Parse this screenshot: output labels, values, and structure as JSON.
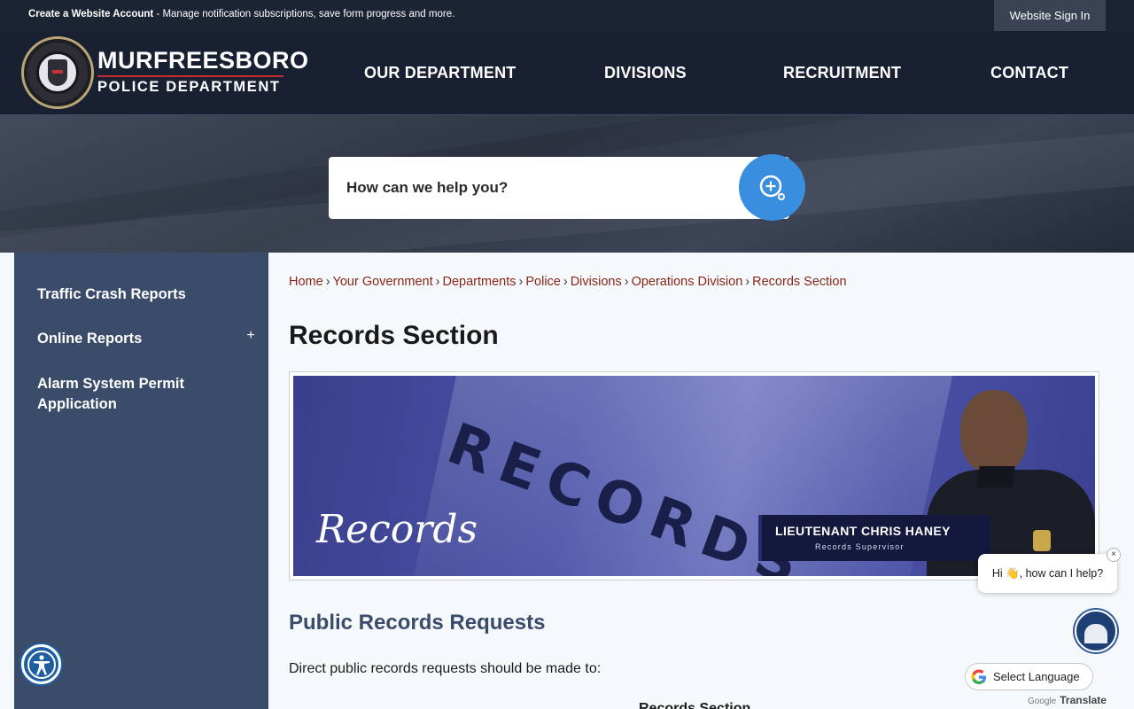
{
  "topbar": {
    "account_strong": "Create a Website Account",
    "account_rest": " - Manage notification subscriptions, save form progress and more.",
    "signin_label": "Website Sign In"
  },
  "header": {
    "logo_line1": "MURFREESBORO",
    "logo_line2": "POLICE DEPARTMENT",
    "nav": [
      "OUR DEPARTMENT",
      "DIVISIONS",
      "RECRUITMENT",
      "CONTACT"
    ]
  },
  "search": {
    "placeholder": "How can we help you?"
  },
  "sidebar": {
    "items": [
      "Traffic Crash Reports",
      "Online Reports",
      "Alarm System Permit Application"
    ],
    "expand_symbol": "+"
  },
  "breadcrumb": [
    "Home",
    "Your Government",
    "Departments",
    "Police",
    "Divisions",
    "Operations Division",
    "Records Section"
  ],
  "breadcrumb_sep": "›",
  "page": {
    "title": "Records Section",
    "banner_script": "Records",
    "banner_sign": "RECORDS",
    "banner_name": "LIEUTENANT CHRIS HANEY",
    "banner_role": "Records Supervisor",
    "section_heading": "Public Records Requests",
    "section_text": "Direct public records requests should be made to:",
    "address_line": "Records Section"
  },
  "chat": {
    "greeting": "Hi 👋, how can I help?",
    "close": "×"
  },
  "translate": {
    "select_label": "Select Language",
    "powered_google": "Google",
    "powered_word": "Translate"
  },
  "colors": {
    "header_bg": "#182032",
    "sidebar_bg": "#3b4b6a",
    "link": "#8a2418",
    "search_button": "#3a8ee0"
  }
}
